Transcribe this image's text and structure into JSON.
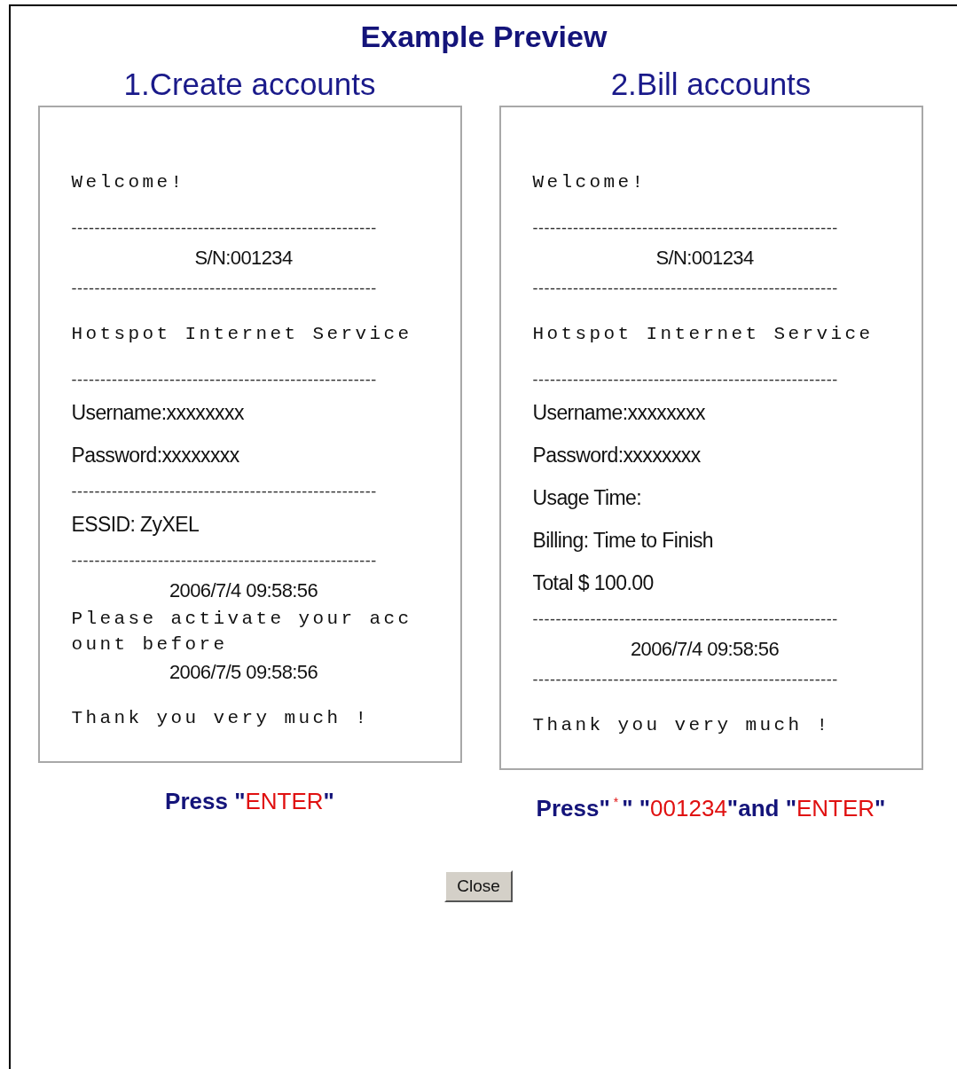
{
  "title": "Example Preview",
  "panels": [
    {
      "heading": "1.Create accounts",
      "lines": [
        {
          "kind": "mono",
          "text": "Welcome!"
        },
        {
          "kind": "rule",
          "text": "-----------------------------------------------------"
        },
        {
          "kind": "center",
          "text": "S/N:001234"
        },
        {
          "kind": "rule",
          "text": "-----------------------------------------------------"
        },
        {
          "kind": "mono",
          "text": "Hotspot Internet Service"
        },
        {
          "kind": "rule",
          "text": "-----------------------------------------------------"
        },
        {
          "kind": "sans",
          "text": "Username:xxxxxxxx"
        },
        {
          "kind": "sans",
          "text": "Password:xxxxxxxx"
        },
        {
          "kind": "rule",
          "text": "-----------------------------------------------------"
        },
        {
          "kind": "sans",
          "text": "ESSID: ZyXEL"
        },
        {
          "kind": "rule",
          "text": "-----------------------------------------------------"
        },
        {
          "kind": "center",
          "text": "2006/7/4 09:58:56"
        },
        {
          "kind": "wrap",
          "text": "Please activate your account before"
        },
        {
          "kind": "center",
          "text": "2006/7/5 09:58:56"
        },
        {
          "kind": "mono",
          "text": "Thank you very much !"
        }
      ],
      "caption": [
        {
          "kind": "plain",
          "text": "Press \""
        },
        {
          "kind": "key",
          "text": "ENTER"
        },
        {
          "kind": "plain",
          "text": "\""
        }
      ]
    },
    {
      "heading": "2.Bill accounts",
      "lines": [
        {
          "kind": "mono",
          "text": "Welcome!"
        },
        {
          "kind": "rule",
          "text": "-----------------------------------------------------"
        },
        {
          "kind": "center",
          "text": "S/N:001234"
        },
        {
          "kind": "rule",
          "text": "-----------------------------------------------------"
        },
        {
          "kind": "mono",
          "text": "Hotspot Internet Service"
        },
        {
          "kind": "rule",
          "text": "-----------------------------------------------------"
        },
        {
          "kind": "sans",
          "text": "Username:xxxxxxxx"
        },
        {
          "kind": "sans",
          "text": "Password:xxxxxxxx"
        },
        {
          "kind": "sans",
          "text": "Usage Time:"
        },
        {
          "kind": "sans",
          "text": "Billing: Time to Finish"
        },
        {
          "kind": "sans",
          "text": "Total $ 100.00"
        },
        {
          "kind": "rule",
          "text": "-----------------------------------------------------"
        },
        {
          "kind": "center",
          "text": "2006/7/4 09:58:56"
        },
        {
          "kind": "rule",
          "text": "-----------------------------------------------------"
        },
        {
          "kind": "mono",
          "text": "Thank you very much !"
        }
      ],
      "caption": [
        {
          "kind": "plain",
          "text": "Press\""
        },
        {
          "kind": "mark",
          "text": "*"
        },
        {
          "kind": "plain",
          "text": "\" \""
        },
        {
          "kind": "key",
          "text": "001234"
        },
        {
          "kind": "plain",
          "text": "\"and \""
        },
        {
          "kind": "key",
          "text": "ENTER"
        },
        {
          "kind": "plain",
          "text": "\""
        }
      ]
    }
  ],
  "button": "Close"
}
